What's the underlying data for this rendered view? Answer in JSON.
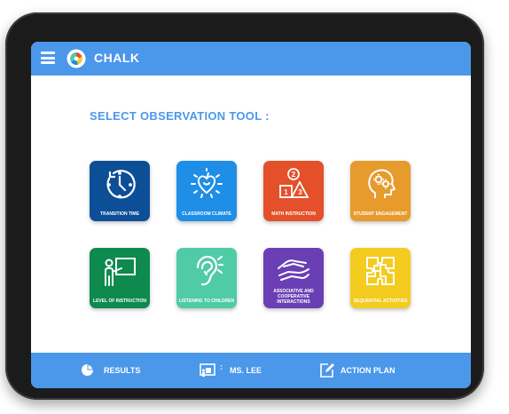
{
  "app": {
    "title": "CHALK"
  },
  "main": {
    "heading": "SELECT OBSERVATION TOOL :"
  },
  "tools": [
    {
      "label": "TRANSITION TIME",
      "color": "#0d4f96",
      "icon": "stopwatch-icon"
    },
    {
      "label": "CLASSROOM CLIMATE",
      "color": "#1f8ee6",
      "icon": "apple-heart-icon"
    },
    {
      "label": "MATH INSTRUCTION",
      "color": "#e4502a",
      "icon": "shapes-numbers-icon"
    },
    {
      "label": "STUDENT ENGAGEMENT",
      "color": "#e69b2c",
      "icon": "head-gears-icon"
    },
    {
      "label": "LEVEL of INSTRUCTION",
      "color": "#0e8a4f",
      "icon": "teacher-board-icon"
    },
    {
      "label": "LISTENING to CHILDREN",
      "color": "#4fcba6",
      "icon": "ear-icon"
    },
    {
      "label": "ASSOCIATIVE and COOPERATIVE INTERACTIONS",
      "color": "#6a3fb5",
      "icon": "handshake-icon"
    },
    {
      "label": "SEQUENTIAL ACTIVITIES",
      "color": "#f3cc1f",
      "icon": "puzzle-icon"
    }
  ],
  "footer": {
    "results_label": "RESULTS",
    "teacher_label": "MS. LEE",
    "action_plan_label": "ACTION PLAN"
  }
}
